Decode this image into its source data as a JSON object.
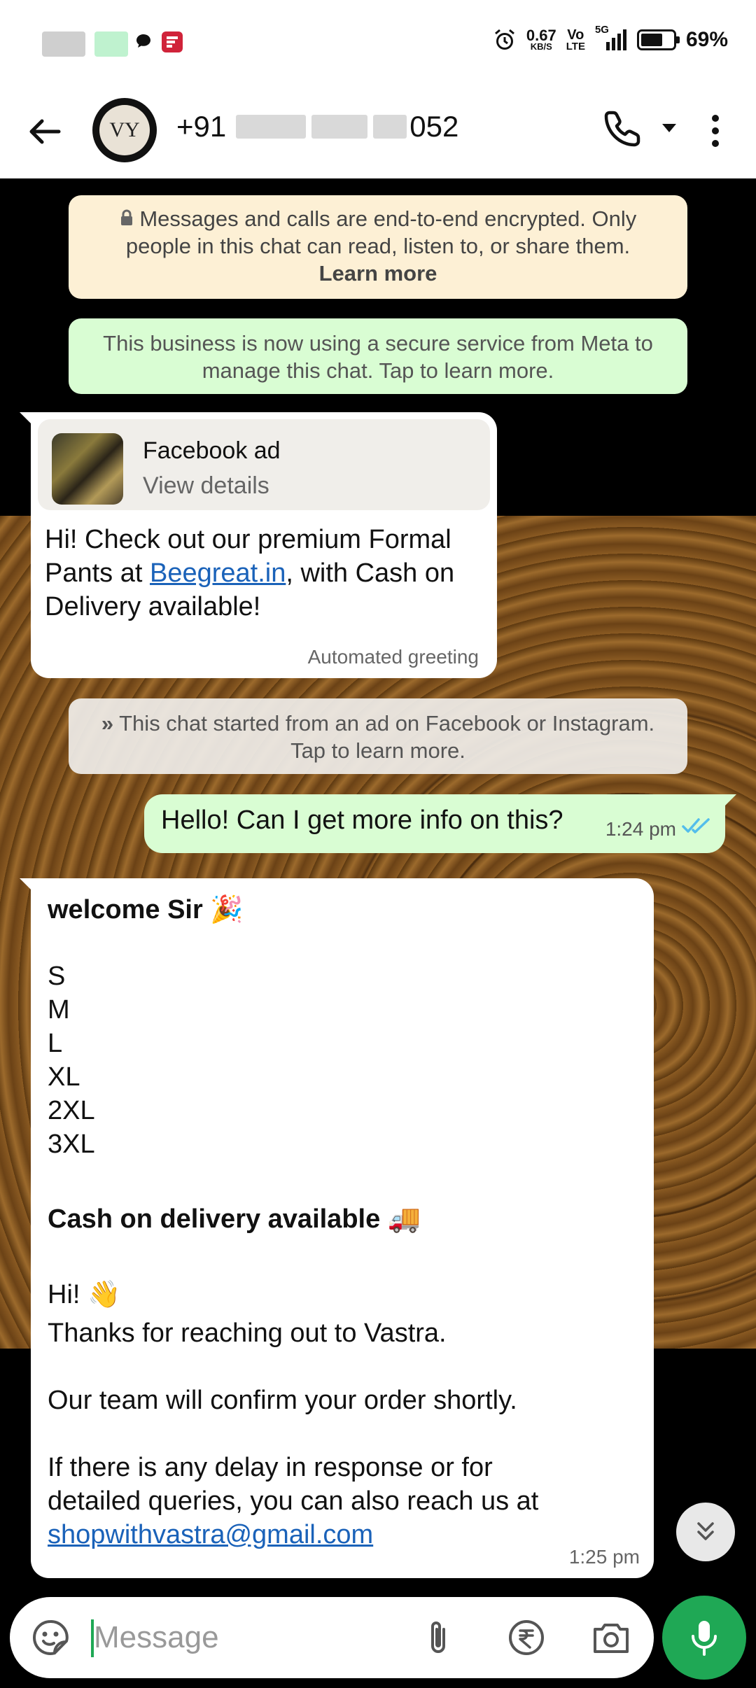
{
  "status_bar": {
    "net_speed": "0.67",
    "net_unit": "KB/S",
    "volte_top": "Vo",
    "volte_bottom": "LTE",
    "network": "5G",
    "battery": "69%",
    "battery_level": 0.69,
    "icons": [
      "notification-blurred",
      "chat-bubble-icon",
      "flipboard-icon",
      "alarm-icon",
      "signal-icon",
      "battery-icon"
    ]
  },
  "header": {
    "avatar_initials": "VY",
    "contact_prefix": "+91",
    "contact_suffix": "052",
    "icons": [
      "back-arrow-icon",
      "phone-icon",
      "caret-down-icon",
      "more-vert-icon"
    ]
  },
  "chat": {
    "encryption_notice": {
      "text": "Messages and calls are end-to-end encrypted. Only people in this chat can read, listen to, or share them.",
      "link": "Learn more"
    },
    "meta_notice": "This business is now using a secure service from Meta to manage this chat. Tap to learn more.",
    "ad_bubble": {
      "card_title": "Facebook ad",
      "card_subtitle": "View details",
      "text_before": "Hi! Check out our premium Formal Pants at ",
      "link": "Beegreat.in",
      "text_after": ", with Cash on Delivery available!",
      "footer": "Automated greeting"
    },
    "ad_notice": "This chat started from an ad on Facebook or Instagram. Tap to learn more.",
    "outgoing": {
      "text": "Hello! Can I get more info on this?",
      "time": "1:24 pm",
      "status": "read"
    },
    "reply": {
      "heading": "welcome Sir",
      "heading_emoji": "🎉",
      "sizes": [
        "S",
        "M",
        "L",
        "XL",
        "2XL",
        "3XL"
      ],
      "cod": "Cash on delivery available",
      "cod_emoji": "🚚",
      "hi": "Hi!",
      "hi_emoji": "👋",
      "thanks": "Thanks for reaching out to Vastra.",
      "confirm": "Our team will confirm your order shortly.",
      "delay_1": "If there is any delay in response or for",
      "delay_2": "detailed queries, you can also reach us at",
      "email": "shopwithvastra@gmail.com",
      "time": "1:25 pm"
    }
  },
  "input": {
    "placeholder": "Message",
    "icons": [
      "sticker-icon",
      "attach-icon",
      "rupee-icon",
      "camera-icon",
      "mic-icon"
    ]
  },
  "colors": {
    "accent_green": "#1fa855",
    "outgoing_bubble": "#d9fdd3",
    "encryption_notice_bg": "#fdf0d5",
    "link_blue": "#1a62b9",
    "read_tick_blue": "#53bdeb"
  }
}
